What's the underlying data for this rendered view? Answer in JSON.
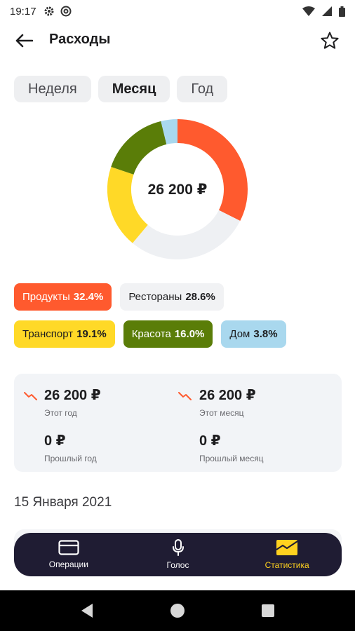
{
  "status_bar": {
    "time": "19:17"
  },
  "header": {
    "title": "Расходы"
  },
  "tabs": [
    {
      "label": "Неделя",
      "active": false
    },
    {
      "label": "Месяц",
      "active": true
    },
    {
      "label": "Год",
      "active": false
    }
  ],
  "donut": {
    "total": "26 200 ₽",
    "segments": [
      {
        "name": "Продукты",
        "value": 32.4,
        "color": "#ff5a2e"
      },
      {
        "name": "Рестораны",
        "value": 28.6,
        "color": "#eef0f3"
      },
      {
        "name": "Транспорт",
        "value": 19.1,
        "color": "#ffd927"
      },
      {
        "name": "Красота",
        "value": 16.0,
        "color": "#5a7d08"
      },
      {
        "name": "Дом",
        "value": 3.8,
        "color": "#a9d8ee"
      }
    ]
  },
  "categories": [
    {
      "name": "Продукты",
      "percent": "32.4%",
      "bg": "#ff5a2e",
      "fg": "#ffffff"
    },
    {
      "name": "Рестораны",
      "percent": "28.6%",
      "bg": "#f1f2f4",
      "fg": "#1d1d1f"
    },
    {
      "name": "Транспорт",
      "percent": "19.1%",
      "bg": "#ffd927",
      "fg": "#1d1d1f"
    },
    {
      "name": "Красота",
      "percent": "16.0%",
      "bg": "#5a7d08",
      "fg": "#ffffff"
    },
    {
      "name": "Дом",
      "percent": "3.8%",
      "bg": "#a9d8ee",
      "fg": "#1d1d1f"
    }
  ],
  "stats": {
    "this_year": {
      "amount": "26 200 ₽",
      "label": "Этот год"
    },
    "this_month": {
      "amount": "26 200 ₽",
      "label": "Этот месяц"
    },
    "last_year": {
      "amount": "0 ₽",
      "label": "Прошлый год"
    },
    "last_month": {
      "amount": "0 ₽",
      "label": "Прошлый месяц"
    }
  },
  "date_header": "15 Января 2021",
  "bottom_nav": [
    {
      "label": "Операции",
      "icon": "card-icon",
      "active": false
    },
    {
      "label": "Голос",
      "icon": "microphone-icon",
      "active": false
    },
    {
      "label": "Статистика",
      "icon": "envelope-icon",
      "active": true
    }
  ],
  "colors": {
    "accent": "#ffd21f",
    "nav_bg": "#1f1c33",
    "trend_down": "#ff5a2e"
  }
}
